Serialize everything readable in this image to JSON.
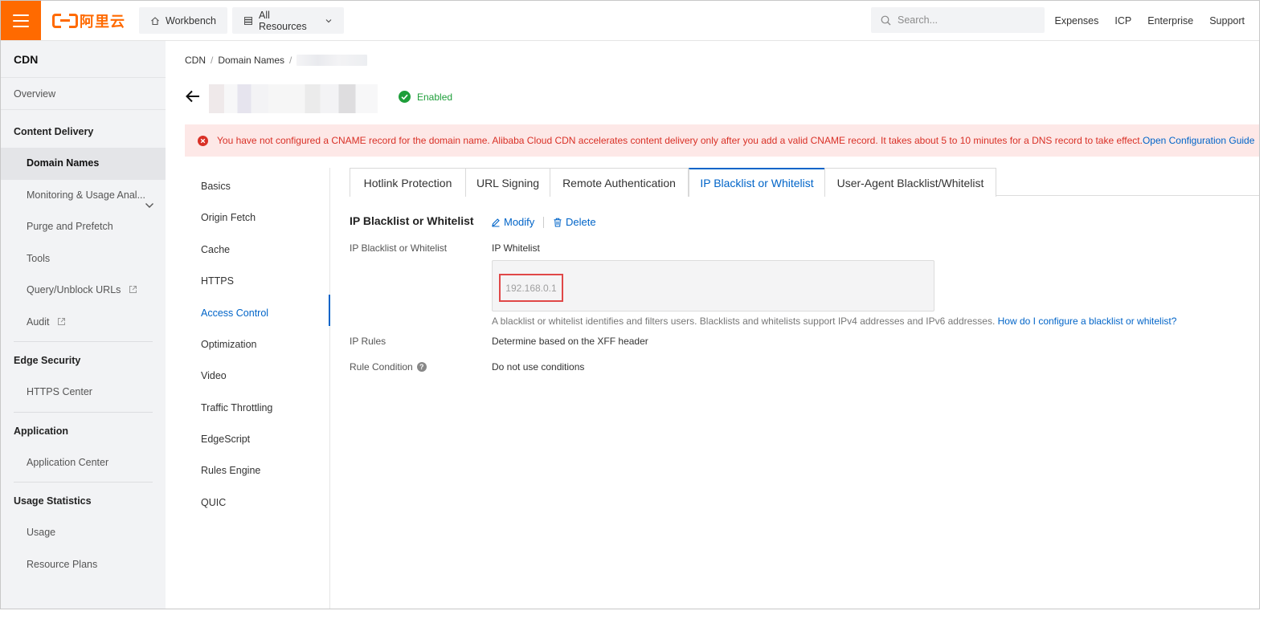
{
  "brand": {
    "logo_text": "阿里云",
    "accent": "#ff6a00"
  },
  "topbar": {
    "workbench_label": "Workbench",
    "all_resources_label": "All Resources",
    "search_placeholder": "Search...",
    "links": [
      "Expenses",
      "ICP",
      "Enterprise",
      "Support"
    ]
  },
  "sidebar": {
    "title": "CDN",
    "overview": "Overview",
    "groups": {
      "content_delivery": "Content Delivery",
      "edge_security": "Edge Security",
      "application": "Application",
      "usage_statistics": "Usage Statistics"
    },
    "items": {
      "domain_names": "Domain Names",
      "monitoring": "Monitoring & Usage Anal...",
      "purge": "Purge and Prefetch",
      "tools": "Tools",
      "query": "Query/Unblock URLs",
      "audit": "Audit",
      "https_center": "HTTPS Center",
      "application_center": "Application Center",
      "usage": "Usage",
      "resource_plans": "Resource Plans"
    }
  },
  "breadcrumb": {
    "root": "CDN",
    "level2": "Domain Names"
  },
  "domain": {
    "status": "Enabled"
  },
  "alert": {
    "message": "You have not configured a CNAME record for the domain name. Alibaba Cloud CDN accelerates content delivery only after you add a valid CNAME record. It takes about 5 to 10 minutes for a DNS record to take effect.",
    "link": "Open Configuration Guide"
  },
  "inner_nav": [
    "Basics",
    "Origin Fetch",
    "Cache",
    "HTTPS",
    "Access Control",
    "Optimization",
    "Video",
    "Traffic Throttling",
    "EdgeScript",
    "Rules Engine",
    "QUIC"
  ],
  "inner_nav_active": "Access Control",
  "tabs": [
    "Hotlink Protection",
    "URL Signing",
    "Remote Authentication",
    "IP Blacklist or Whitelist",
    "User-Agent Blacklist/Whitelist"
  ],
  "tabs_active": "IP Blacklist or Whitelist",
  "section": {
    "title": "IP Blacklist or Whitelist",
    "modify": "Modify",
    "delete": "Delete",
    "fields": {
      "list_label": "IP Blacklist or Whitelist",
      "list_value": "IP Whitelist",
      "ip_value": "192.168.0.1",
      "hint": "A blacklist or whitelist identifies and filters users. Blacklists and whitelists support IPv4 addresses and IPv6 addresses. ",
      "hint_link": "How do I configure a blacklist or whitelist?",
      "rules_label": "IP Rules",
      "rules_value": "Determine based on the XFF header",
      "condition_label": "Rule Condition",
      "condition_value": "Do not use conditions"
    }
  },
  "colors": {
    "link": "#0064c8",
    "success": "#1e9e3a",
    "error": "#d93026",
    "alert_bg": "#fde8e7",
    "highlight_box": "#e04848"
  }
}
